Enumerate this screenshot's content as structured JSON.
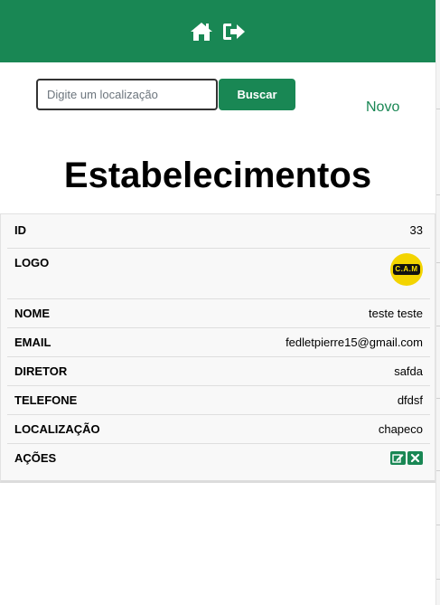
{
  "header": {
    "icons": [
      "home-icon",
      "sign-out-icon"
    ],
    "color": "#198754"
  },
  "search": {
    "placeholder": "Digite um localização",
    "value": "",
    "button_label": "Buscar"
  },
  "novo_label": "Novo",
  "page_title": "Estabelecimentos",
  "establishment": {
    "fields": [
      {
        "label": "ID",
        "value": "33"
      },
      {
        "label": "LOGO",
        "value": "C.A.M"
      },
      {
        "label": "NOME",
        "value": "teste teste"
      },
      {
        "label": "EMAIL",
        "value": "fedletpierre15@gmail.com"
      },
      {
        "label": "DIRETOR",
        "value": "safda"
      },
      {
        "label": "TELEFONE",
        "value": "dfdsf"
      },
      {
        "label": "LOCALIZAÇÃO",
        "value": "chapeco"
      },
      {
        "label": "AÇÕES",
        "value": ""
      }
    ],
    "actions": [
      "edit-icon",
      "delete-icon"
    ]
  }
}
